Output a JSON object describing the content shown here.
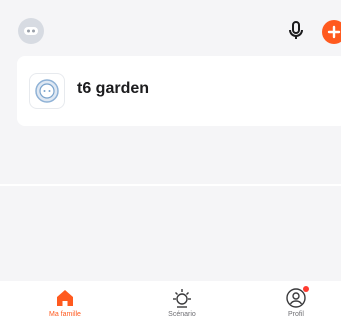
{
  "header": {
    "avatar_icon": "family-avatar-icon",
    "mic_icon": "microphone-icon",
    "add_icon": "plus-icon",
    "accent_color": "#ff5a1f"
  },
  "devices": [
    {
      "name": "t6 garden",
      "icon": "smart-plug-icon"
    }
  ],
  "tabbar": {
    "tabs": [
      {
        "label": "Ma famille",
        "icon": "home-icon",
        "active": true
      },
      {
        "label": "Scénario",
        "icon": "sun-icon",
        "active": false
      },
      {
        "label": "Profil",
        "icon": "profile-icon",
        "active": false,
        "badge": true
      }
    ]
  }
}
